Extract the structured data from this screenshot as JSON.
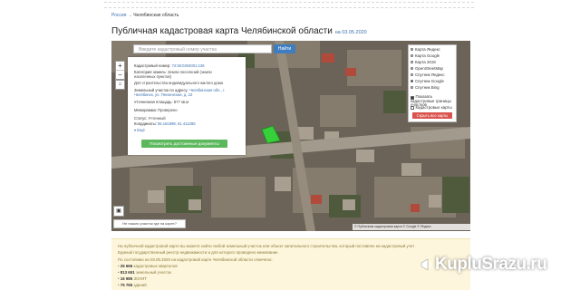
{
  "breadcrumb": {
    "link": "Россия",
    "sep": "→",
    "current": "Челябинская область"
  },
  "page": {
    "title": "Публичная кадастровая карта Челябинской области",
    "date": "на 03.05.2020"
  },
  "search": {
    "placeholder": "Введите кадастровый номер участка",
    "button": "Найти"
  },
  "map_controls": {
    "zoom_in": "+",
    "zoom_out": "−",
    "home": "⌂",
    "legend": "▣"
  },
  "card": {
    "cad_label": "Кадастровый номер:",
    "cad_value": "74:36:0204001:136",
    "cat_label": "Категория земель:",
    "cat_value": "Земли поселений (земли населенных пунктов)",
    "use_value": "Для строительства индивидуального жилого дома",
    "addr_label": "Земельный участок по адресу:",
    "addr_value": "Челябинская обл., г. Челябинск, ул. Пензенская, д. 22",
    "area_label": "Уточненная площадь:",
    "area_value": "877 кв.м",
    "own_label": "Меморамма:",
    "own_value": "Проверено",
    "status_label": "Статус:",
    "status_value": "Учтенный",
    "coords_label": "Координаты:",
    "coords_value": "55.181898, 61.411286",
    "more": "▾ Ещё",
    "button": "Посмотреть достоинные документы"
  },
  "layers": {
    "options": [
      {
        "label": "Карта Яндекс",
        "on": false
      },
      {
        "label": "Карта Google",
        "on": false
      },
      {
        "label": "Карта 2GIS",
        "on": false
      },
      {
        "label": "OpenStreetMap",
        "on": false
      },
      {
        "label": "Спутник Яндекс",
        "on": false
      },
      {
        "label": "Спутник Google",
        "on": true
      },
      {
        "label": "Спутник Bing",
        "on": false
      }
    ],
    "chk1": "Показать кадастровые границы участков",
    "chk2": "Кадастровые карты",
    "close": "Скрыть все карты"
  },
  "map_notfound": "Не нашли участок где на карте?",
  "attribution": "© Публичная кадастровая карта © Google © Яндекс",
  "info": {
    "line1": "На публичной кадастровой карте вы можете найти любой земельный участок или объект капитального строительства, который поставлен на кадастровый учет",
    "line2": "Единый государственный реестр недвижимости и для которого проведено межевание.",
    "line3": "По состоянию на 03.05.2020 на кадастровой карте Челябинской области отмечено:",
    "stats": [
      {
        "num": "26 666",
        "text": "кадастровых кварталов"
      },
      {
        "num": "813 651",
        "text": "земельный участок"
      },
      {
        "num": "16 985",
        "text": "ЗОУИТ"
      },
      {
        "num": "75 765",
        "text": "зданий"
      }
    ]
  },
  "watermark": {
    "text": "KupluSrazu.ru"
  }
}
